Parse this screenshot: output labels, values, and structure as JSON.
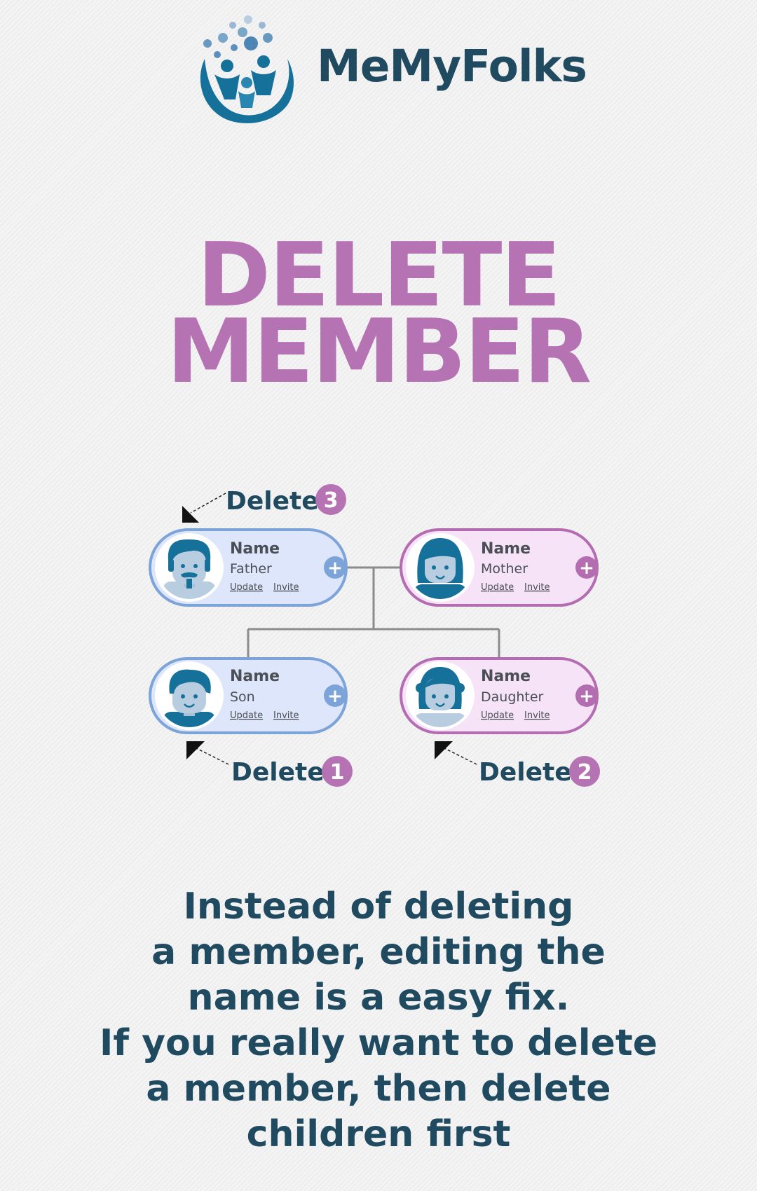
{
  "brand": {
    "name": "MeMyFolks"
  },
  "headline": {
    "line1": "DELETE",
    "line2": "MEMBER"
  },
  "members": {
    "father": {
      "name": "Name",
      "role": "Father",
      "update": "Update",
      "invite": "Invite"
    },
    "mother": {
      "name": "Name",
      "role": "Mother",
      "update": "Update",
      "invite": "Invite"
    },
    "son": {
      "name": "Name",
      "role": "Son",
      "update": "Update",
      "invite": "Invite"
    },
    "daughter": {
      "name": "Name",
      "role": "Daughter",
      "update": "Update",
      "invite": "Invite"
    }
  },
  "plus_symbol": "+",
  "delete_markers": {
    "first": {
      "label": "Delete",
      "order": "1"
    },
    "second": {
      "label": "Delete",
      "order": "2"
    },
    "third": {
      "label": "Delete",
      "order": "3"
    }
  },
  "footer": {
    "line1": "Instead of deleting",
    "line2": "a member, editing the",
    "line3": "name is a easy fix.",
    "line4": "If you really want to delete",
    "line5": "a member, then delete",
    "line6": "children first"
  },
  "colors": {
    "brand_text": "#1f4a60",
    "headline": "#b673b3",
    "male_card_fill": "#dde6fb",
    "male_card_border": "#7da4d8",
    "female_card_fill": "#f6e3f8",
    "female_card_border": "#b46db1",
    "connector": "#8c8c8c",
    "avatar_blue": "#15719a"
  },
  "icons": {
    "logo": "family-tree-logo",
    "father_avatar": "man-mustache-avatar",
    "mother_avatar": "woman-avatar",
    "son_avatar": "boy-avatar",
    "daughter_avatar": "girl-avatar",
    "pointer": "arrow-pointer-icon"
  }
}
